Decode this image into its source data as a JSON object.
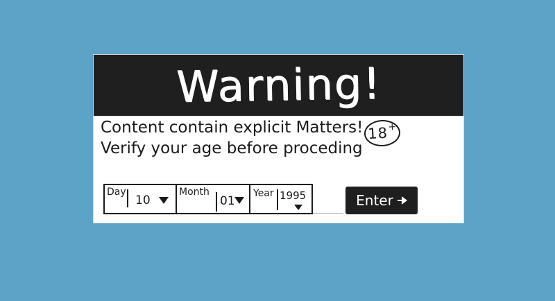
{
  "colors": {
    "background": "#5da3c8",
    "header": "#1f1f1f",
    "dialog": "#ffffff",
    "button": "#1f1f1f"
  },
  "dialog": {
    "title": "Warning!",
    "message_line_1": "Content contain explicit Matters!",
    "message_line_2": "Verify your age before proceding",
    "age_badge": "18",
    "age_badge_suffix": "+"
  },
  "date": {
    "day": {
      "label": "Day",
      "value": "10",
      "icon": "caret-down-icon"
    },
    "month": {
      "label": "Month",
      "value": "01",
      "icon": "caret-down-icon"
    },
    "year": {
      "label": "Year",
      "value": "1995",
      "icon": "caret-down-icon"
    }
  },
  "enter_button": {
    "label": "Enter",
    "icon": "arrow-right-icon"
  }
}
